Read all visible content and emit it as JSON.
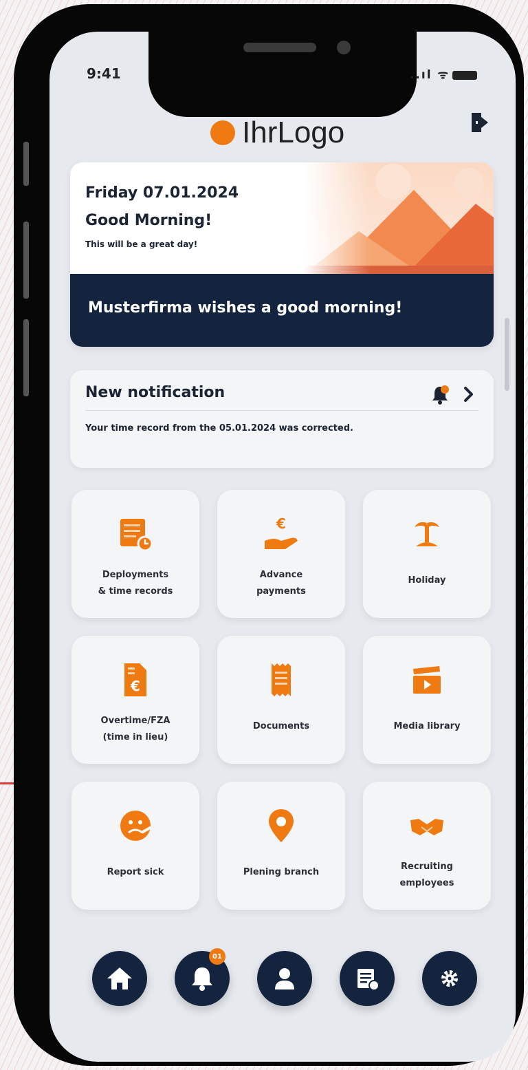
{
  "status_bar": {
    "time": "9:41",
    "signal": "..ıl ᯤ"
  },
  "header": {
    "logo_text": "IhrLogo"
  },
  "hero": {
    "date": "Friday 07.01.2024",
    "greeting": "Good Morning!",
    "subtitle": "This will be a great day!",
    "banner": "Musterfirma wishes a good morning!"
  },
  "notification": {
    "title": "New notification",
    "text": "Your time record from the 05.01.2024 was corrected."
  },
  "tiles": [
    {
      "label": "Deployments\n& time records",
      "icon": "time-records-icon"
    },
    {
      "label": "Advance\npayments",
      "icon": "euro-hand-icon"
    },
    {
      "label": "Holiday",
      "icon": "palm-island-icon"
    },
    {
      "label": "Overtime/FZA\n(time in lieu)",
      "icon": "euro-document-icon"
    },
    {
      "label": "Documents",
      "icon": "receipt-icon"
    },
    {
      "label": "Media library",
      "icon": "clapperboard-icon"
    },
    {
      "label": "Report sick",
      "icon": "sick-face-icon"
    },
    {
      "label": "Plening branch",
      "icon": "location-pin-icon"
    },
    {
      "label": "Recruiting\nemployees",
      "icon": "handshake-icon"
    }
  ],
  "bottom_nav": {
    "items": [
      "home",
      "notifications",
      "profile",
      "records",
      "settings"
    ],
    "notification_badge": "01"
  },
  "colors": {
    "accent": "#f07a12",
    "navy": "#14243f",
    "background": "#e6e9ee"
  }
}
